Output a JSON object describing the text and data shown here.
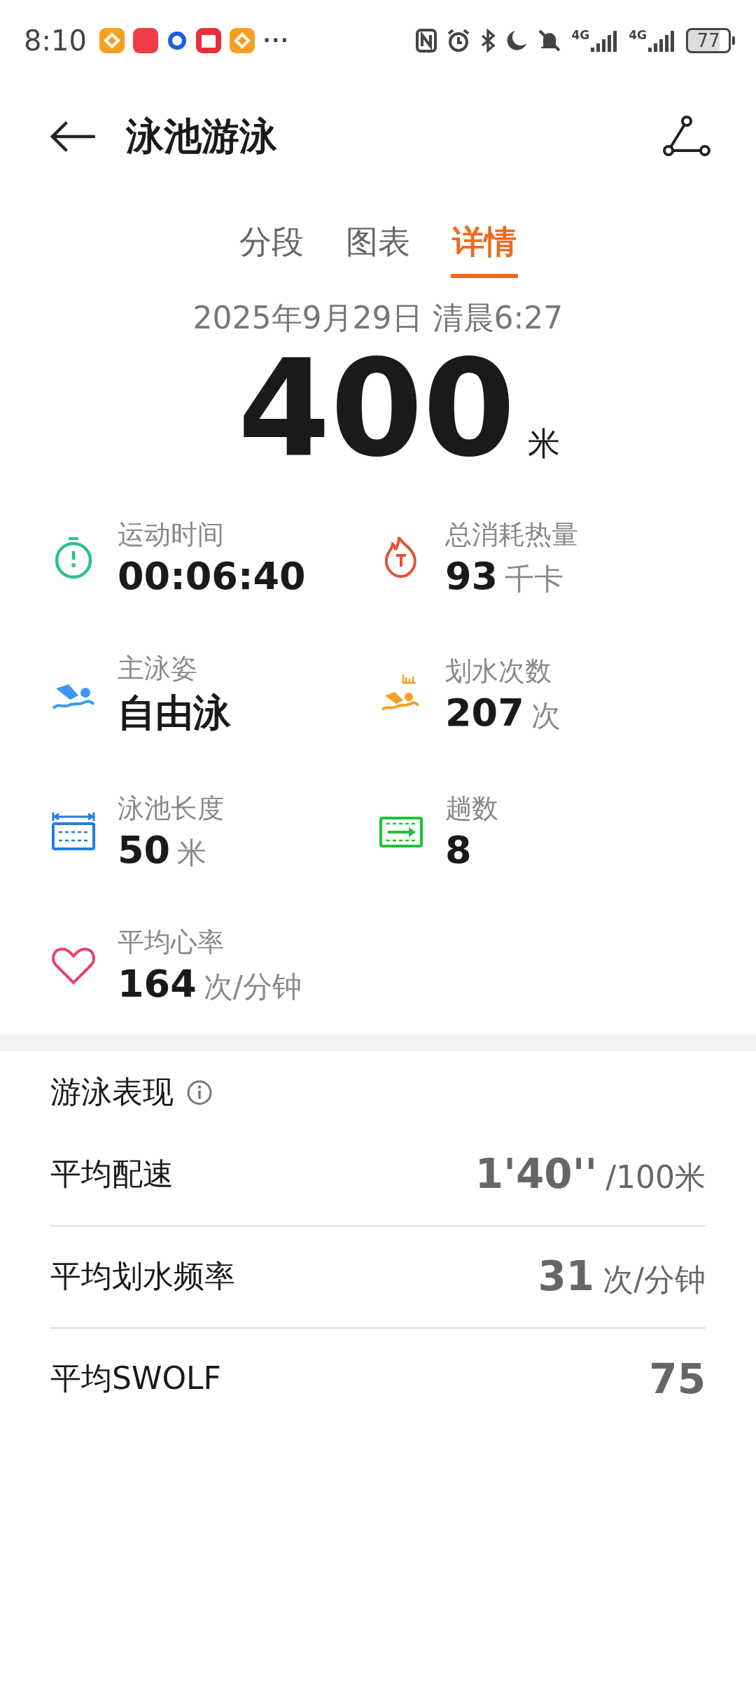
{
  "status_bar": {
    "time": "8:10",
    "more": "···",
    "network": [
      "4G",
      "4G"
    ],
    "battery": "77"
  },
  "header": {
    "title": "泳池游泳"
  },
  "tabs": [
    {
      "label": "分段",
      "selected": false
    },
    {
      "label": "图表",
      "selected": false
    },
    {
      "label": "详情",
      "selected": true
    }
  ],
  "date": "2025年9月29日 清晨6:27",
  "distance": {
    "value": "400",
    "unit": "米"
  },
  "stats": [
    {
      "kind": "stopwatch",
      "color": "#2fbf8f",
      "label": "运动时间",
      "value": "00:06:40"
    },
    {
      "kind": "flame",
      "color": "#e8502f",
      "label": "总消耗热量",
      "value": "93",
      "unit": "千卡"
    },
    {
      "kind": "swimmer",
      "color": "#3d97f0",
      "label": "主泳姿",
      "value": "自由泳"
    },
    {
      "kind": "strokes",
      "color": "#f5a023",
      "label": "划水次数",
      "value": "207",
      "unit": "次"
    },
    {
      "kind": "pool",
      "color": "#1f7fe0",
      "label": "泳池长度",
      "value": "50",
      "unit": "米"
    },
    {
      "kind": "laps",
      "color": "#1fc23a",
      "label": "趟数",
      "value": "8"
    },
    {
      "kind": "heart",
      "color": "#e2456a",
      "label": "平均心率",
      "value": "164",
      "unit": "次/分钟"
    }
  ],
  "performance": {
    "title": "游泳表现",
    "rows": [
      {
        "label": "平均配速",
        "value": "1'40''",
        "unit": "/100米"
      },
      {
        "label": "平均划水频率",
        "value": "31",
        "unit": "次/分钟"
      },
      {
        "label": "平均SWOLF",
        "value": "75"
      }
    ]
  }
}
